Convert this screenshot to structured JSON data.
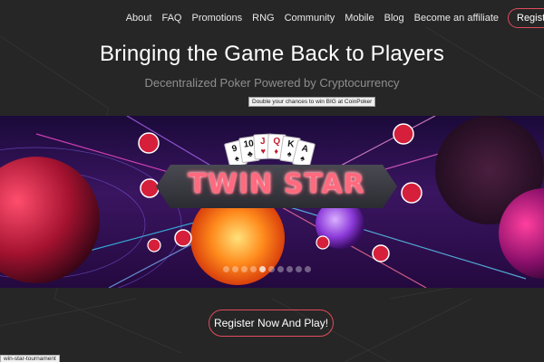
{
  "nav": {
    "items": [
      {
        "label": "About"
      },
      {
        "label": "FAQ"
      },
      {
        "label": "Promotions"
      },
      {
        "label": "RNG"
      },
      {
        "label": "Community"
      },
      {
        "label": "Mobile"
      },
      {
        "label": "Blog"
      },
      {
        "label": "Become an affiliate"
      }
    ],
    "register_label": "Register"
  },
  "hero": {
    "title": "Bringing the Game Back to Players",
    "subtitle": "Decentralized Poker Powered by Cryptocurrency"
  },
  "banner": {
    "tooltip": "Double your chances to win BIG at CoinPoker",
    "logo_text": "TWIN STAR",
    "cards": [
      {
        "rank": "9",
        "suit": "♠"
      },
      {
        "rank": "10",
        "suit": "♣"
      },
      {
        "rank": "J",
        "suit": "♥"
      },
      {
        "rank": "Q",
        "suit": "♦"
      },
      {
        "rank": "K",
        "suit": "♠"
      },
      {
        "rank": "A",
        "suit": "♠"
      }
    ],
    "slide_count": 10,
    "active_slide": 4,
    "chip_icon": "coinpoker-chip-icon"
  },
  "cta": {
    "label": "Register Now And Play!"
  },
  "status_bar": {
    "url": "win-star-tournament"
  },
  "colors": {
    "background": "#262626",
    "accent": "#e14b5c",
    "logo": "#ff6a7e"
  }
}
